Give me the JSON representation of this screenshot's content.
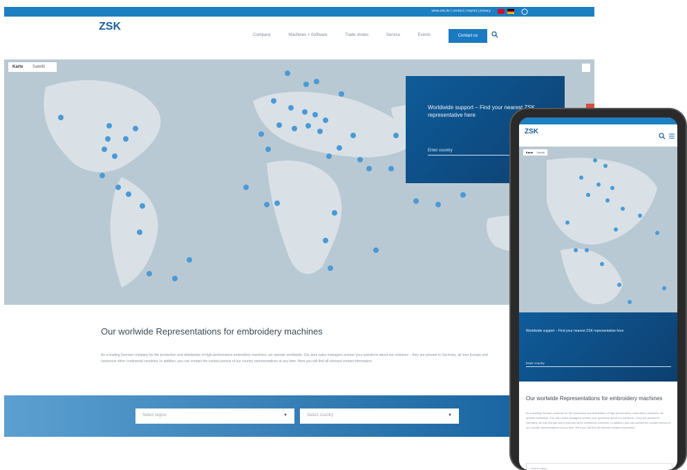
{
  "topbar": {
    "links": "www.zsk.de | contact | imprint | privacy",
    "language_flags": [
      "uk-flag",
      "de-flag"
    ]
  },
  "header": {
    "logo_text": "ZSK",
    "nav": [
      "Company",
      "Machines + Software",
      "Trade shows",
      "Service",
      "Events"
    ],
    "contact_label": "Contact us"
  },
  "map": {
    "tabs": [
      "Karte",
      "Satellit"
    ],
    "support_title": "Worldwide support – Find your nearest ZSK representative here",
    "support_input_label": "Enter country"
  },
  "intro": {
    "title": "Our worlwide Representations for embroidery machines",
    "text": "As a leading German company for the production and distribution of high-performance embroidery machines, we operate worldwide. Our area sales managers answer your questions about our solutions – they are present in Germany, all over Europe and numerous other continental countries. In addition, you can contact the contact person of our country representatives at any time. Here you will find all relevant contact information."
  },
  "filters": [
    {
      "label": "Select region"
    },
    {
      "label": "Select country"
    }
  ],
  "phone": {
    "support_title": "Worldwide support – Find your nearest ZSK representative here",
    "support_input_label": "Enter country",
    "intro_title": "Our worlwide Representations for embroidery machines",
    "intro_text": "As a leading German company for the production and distribution of high-performance embroidery machines, we operate worldwide. Our area sales managers answer your questions about our solutions – they are present in Germany, all over Europe and numerous other continental countries. In addition, you can contact the contact person of our country representatives at any time. Here you will find all relevant contact information.",
    "select_label": "Select region"
  },
  "colors": {
    "brand_blue": "#1c7fc1",
    "support_box": "#0f5c9a",
    "pin": "#4a9ad6"
  }
}
